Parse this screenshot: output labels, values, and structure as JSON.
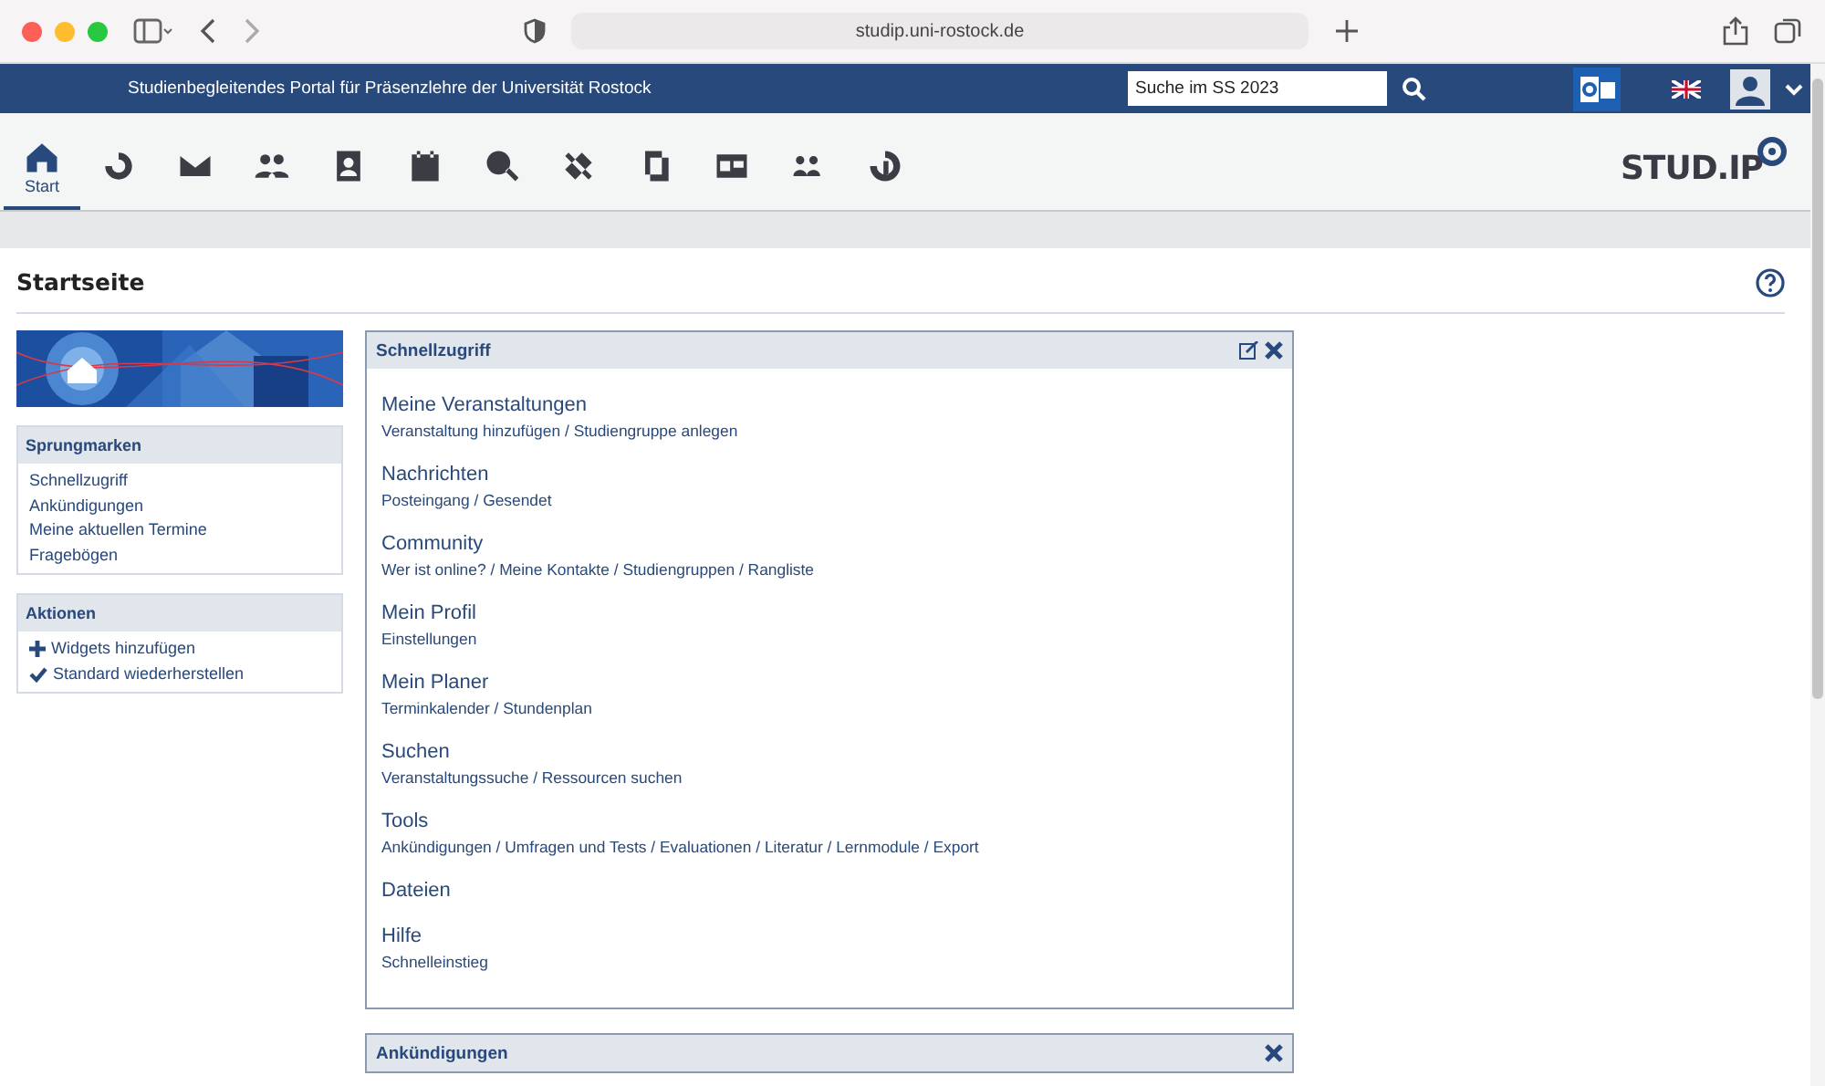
{
  "browser": {
    "url": "studip.uni-rostock.de"
  },
  "header": {
    "title": "Studienbegleitendes Portal für Präsenzlehre der Universität Rostock",
    "search": {
      "placeholder": "Suche im SS 2023"
    }
  },
  "nav": [
    {
      "label": "Start",
      "selected": true
    },
    {
      "selected": false
    },
    {
      "selected": false
    },
    {
      "selected": false
    },
    {
      "selected": false
    },
    {
      "selected": false
    },
    {
      "selected": false
    },
    {
      "selected": false
    },
    {
      "selected": false
    },
    {
      "selected": false
    },
    {
      "selected": false
    },
    {
      "selected": false
    }
  ],
  "logo": {
    "text": "STUD.IP"
  },
  "page_title": "Startseite",
  "sidebar": [
    {
      "title": "Sprungmarken",
      "items": [
        {
          "label": "Schnellzugriff",
          "kind": "link"
        },
        {
          "label": "Ankündigungen",
          "kind": "link"
        },
        {
          "label": "Meine aktuellen Termine",
          "kind": "link"
        },
        {
          "label": "Fragebögen",
          "kind": "link"
        }
      ]
    },
    {
      "title": "Aktionen",
      "items": [
        {
          "label": "Widgets hinzufügen",
          "kind": "add"
        },
        {
          "label": "Standard wiederherstellen",
          "kind": "check"
        }
      ]
    }
  ],
  "widgets": [
    {
      "title": "Schnellzugriff",
      "editable": true,
      "separator": " / ",
      "sections": [
        {
          "title": "Meine Veranstaltungen",
          "links": [
            "Veranstaltung hinzufügen",
            "Studiengruppe anlegen"
          ]
        },
        {
          "title": "Nachrichten",
          "links": [
            "Posteingang",
            "Gesendet"
          ]
        },
        {
          "title": "Community",
          "links": [
            "Wer ist online?",
            "Meine Kontakte",
            "Studiengruppen",
            "Rangliste"
          ]
        },
        {
          "title": "Mein Profil",
          "links": [
            "Einstellungen"
          ]
        },
        {
          "title": "Mein Planer",
          "links": [
            "Terminkalender",
            "Stundenplan"
          ]
        },
        {
          "title": "Suchen",
          "links": [
            "Veranstaltungssuche",
            "Ressourcen suchen"
          ]
        },
        {
          "title": "Tools",
          "links": [
            "Ankündigungen",
            "Umfragen und Tests",
            "Evaluationen",
            "Literatur",
            "Lernmodule",
            "Export"
          ]
        },
        {
          "title": "Dateien"
        },
        {
          "title": "Hilfe",
          "links": [
            "Schnelleinstieg"
          ]
        }
      ]
    },
    {
      "title": "Ankündigungen",
      "editable": false
    }
  ]
}
